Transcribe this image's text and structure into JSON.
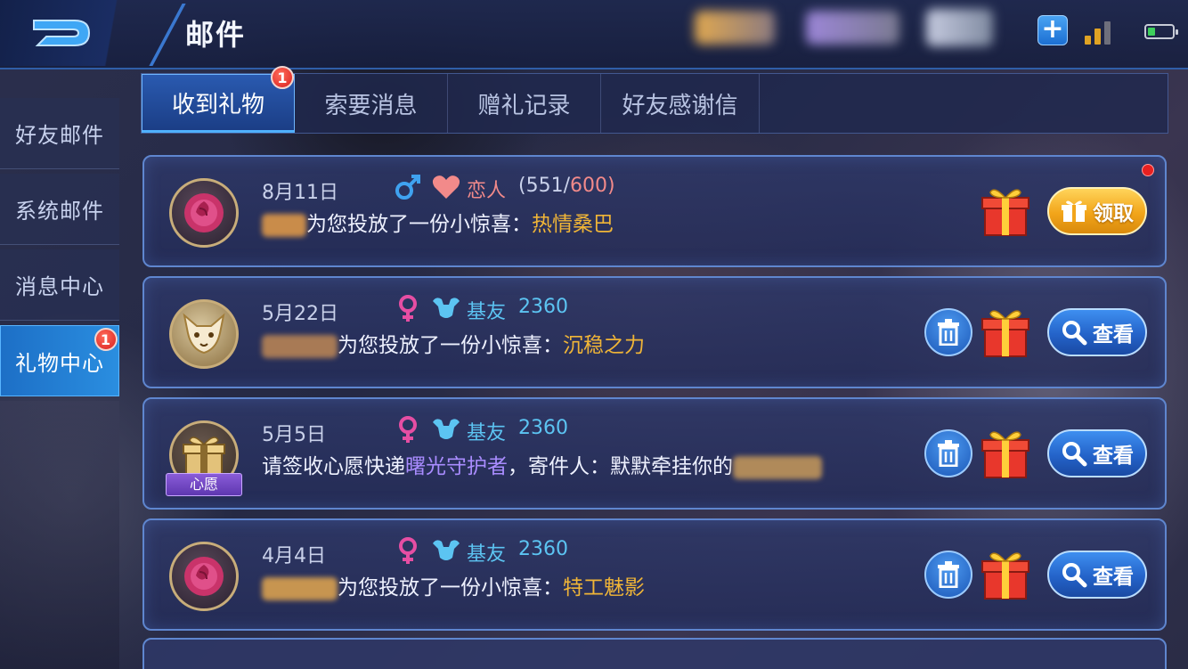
{
  "header": {
    "title": "邮件",
    "plus_label": "+",
    "back_icon": "back-arrow-icon",
    "signal_bars": 2,
    "signal_bars_total": 3,
    "battery_level": 0.3
  },
  "colors": {
    "accent": "#2a8ee0",
    "gold": "#f0b537",
    "badge_red": "#d9201e",
    "male_blue": "#3fa2f0",
    "female_pink": "#e64ea3",
    "lover_pink": "#f28a8a",
    "friend_blue": "#5cc4f2",
    "purple_item": "#a98cff"
  },
  "sidebar": {
    "items": [
      {
        "label": "好友邮件",
        "badge": ""
      },
      {
        "label": "系统邮件",
        "badge": ""
      },
      {
        "label": "消息中心",
        "badge": ""
      },
      {
        "label": "礼物中心",
        "badge": "1",
        "active": true
      }
    ]
  },
  "tabs": [
    {
      "label": "收到礼物",
      "badge": "1",
      "active": true
    },
    {
      "label": "索要消息",
      "badge": ""
    },
    {
      "label": "赠礼记录",
      "badge": ""
    },
    {
      "label": "好友感谢信",
      "badge": ""
    }
  ],
  "mails": [
    {
      "date": "8月11日",
      "gender": "male",
      "relation_icon": "heart-icon",
      "relation": "恋人",
      "intimacy_open": "(551/",
      "intimacy_max": "600)",
      "message": "为您投放了一份小惊喜：",
      "gift": "热情桑巴",
      "action": "领取",
      "avatar": "rose-avatar",
      "unread": true
    },
    {
      "date": "5月22日",
      "gender": "female",
      "relation_icon": "muscle-icon",
      "relation": "基友",
      "intimacy": "2360",
      "message": "为您投放了一份小惊喜：",
      "gift": "沉稳之力",
      "action": "查看",
      "avatar": "fox-avatar"
    },
    {
      "date": "5月5日",
      "gender": "female",
      "relation_icon": "muscle-icon",
      "relation": "基友",
      "intimacy": "2360",
      "message_prefix": "请签收心愿快递",
      "gift": "曙光守护者",
      "message_suffix": "，寄件人：默默牵挂你的",
      "tag": "心愿",
      "action": "查看",
      "avatar": "gift-avatar"
    },
    {
      "date": "4月4日",
      "gender": "female",
      "relation_icon": "muscle-icon",
      "relation": "基友",
      "intimacy": "2360",
      "message": "为您投放了一份小惊喜：",
      "gift": "特工魅影",
      "action": "查看",
      "avatar": "rose-avatar"
    }
  ]
}
